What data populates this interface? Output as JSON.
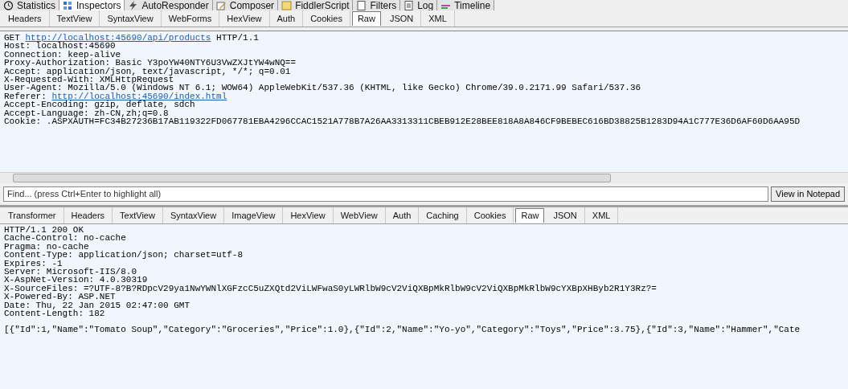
{
  "main_tabs": [
    {
      "label": "Statistics",
      "selected": false
    },
    {
      "label": "Inspectors",
      "selected": true
    },
    {
      "label": "AutoResponder",
      "selected": false
    },
    {
      "label": "Composer",
      "selected": false
    },
    {
      "label": "FiddlerScript",
      "selected": false
    },
    {
      "label": "Filters",
      "selected": false
    },
    {
      "label": "Log",
      "selected": false
    },
    {
      "label": "Timeline",
      "selected": false
    }
  ],
  "request": {
    "tabs": [
      {
        "label": "Headers",
        "selected": false
      },
      {
        "label": "TextView",
        "selected": false
      },
      {
        "label": "SyntaxView",
        "selected": false
      },
      {
        "label": "WebForms",
        "selected": false
      },
      {
        "label": "HexView",
        "selected": false
      },
      {
        "label": "Auth",
        "selected": false
      },
      {
        "label": "Cookies",
        "selected": false
      },
      {
        "label": "Raw",
        "selected": true
      },
      {
        "label": "JSON",
        "selected": false
      },
      {
        "label": "XML",
        "selected": false
      }
    ],
    "lines": [
      [
        {
          "text": "GET ",
          "link": false
        },
        {
          "text": "http://localhost:45690/api/products",
          "link": true
        },
        {
          "text": " HTTP/1.1",
          "link": false
        }
      ],
      [
        {
          "text": "Host: localhost:45690",
          "link": false
        }
      ],
      [
        {
          "text": "Connection: keep-alive",
          "link": false
        }
      ],
      [
        {
          "text": "Proxy-Authorization: Basic Y3poYW40NTY6U3VwZXJtYW4wNQ==",
          "link": false
        }
      ],
      [
        {
          "text": "Accept: application/json, text/javascript, */*; q=0.01",
          "link": false
        }
      ],
      [
        {
          "text": "X-Requested-With: XMLHttpRequest",
          "link": false
        }
      ],
      [
        {
          "text": "User-Agent: Mozilla/5.0 (Windows NT 6.1; WOW64) AppleWebKit/537.36 (KHTML, like Gecko) Chrome/39.0.2171.99 Safari/537.36",
          "link": false
        }
      ],
      [
        {
          "text": "Referer: ",
          "link": false
        },
        {
          "text": "http://localhost:45690/index.html",
          "link": true
        }
      ],
      [
        {
          "text": "Accept-Encoding: gzip, deflate, sdch",
          "link": false
        }
      ],
      [
        {
          "text": "Accept-Language: zh-CN,zh;q=0.8",
          "link": false
        }
      ],
      [
        {
          "text": "Cookie: .ASPXAUTH=FC34B27236B17AB119322FD067781EBA4296CCAC1521A778B7A26AA3313311CBEB912E28BEE818A8A846CF9BEBEC616BD38825B1283D94A1C777E36D6AF60D6AA95D",
          "link": false
        }
      ]
    ],
    "find": {
      "placeholder": "Find... (press Ctrl+Enter to highlight all)"
    },
    "notepad_button": "View in Notepad"
  },
  "response": {
    "tabs": [
      {
        "label": "Transformer",
        "selected": false
      },
      {
        "label": "Headers",
        "selected": false
      },
      {
        "label": "TextView",
        "selected": false
      },
      {
        "label": "SyntaxView",
        "selected": false
      },
      {
        "label": "ImageView",
        "selected": false
      },
      {
        "label": "HexView",
        "selected": false
      },
      {
        "label": "WebView",
        "selected": false
      },
      {
        "label": "Auth",
        "selected": false
      },
      {
        "label": "Caching",
        "selected": false
      },
      {
        "label": "Cookies",
        "selected": false
      },
      {
        "label": "Raw",
        "selected": true
      },
      {
        "label": "JSON",
        "selected": false
      },
      {
        "label": "XML",
        "selected": false
      }
    ],
    "lines": [
      "HTTP/1.1 200 OK",
      "Cache-Control: no-cache",
      "Pragma: no-cache",
      "Content-Type: application/json; charset=utf-8",
      "Expires: -1",
      "Server: Microsoft-IIS/8.0",
      "X-AspNet-Version: 4.0.30319",
      "X-SourceFiles: =?UTF-8?B?RDpcV29ya1NwYWNlXGFzcC5uZXQtd2ViLWFwaS0yLWRlbW9cV2ViQXBpMkRlbW9cV2ViQXBpMkRlbW9cYXBpXHByb2R1Y3Rz?=",
      "X-Powered-By: ASP.NET",
      "Date: Thu, 22 Jan 2015 02:47:00 GMT",
      "Content-Length: 182"
    ],
    "body": [
      "[{\"Id\":1,\"Name\":\"Tomato Soup\",\"Category\":\"Groceries\",\"Price\":1.0},{\"Id\":2,\"Name\":\"Yo-yo\",\"Category\":\"Toys\",\"Price\":3.75},{\"Id\":3,\"Name\":\"Hammer\",\"Cate"
    ]
  }
}
